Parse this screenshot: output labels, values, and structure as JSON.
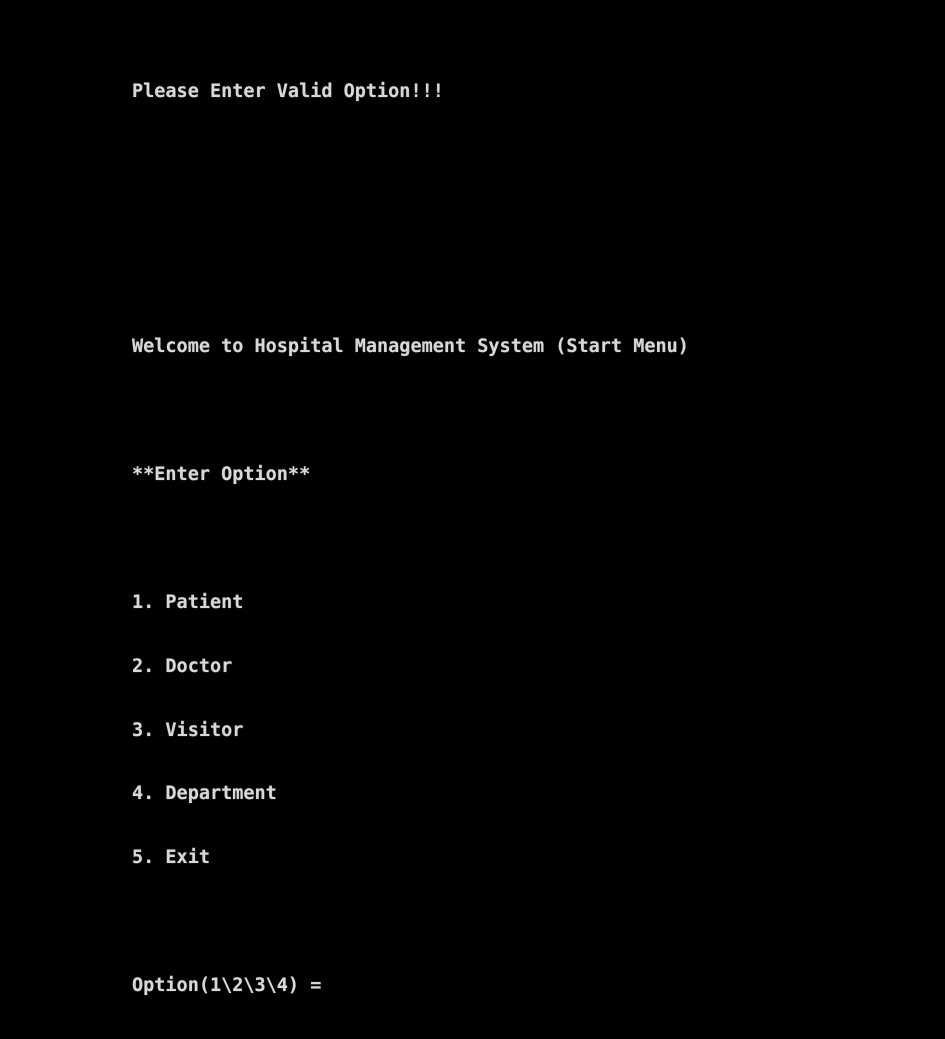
{
  "console": {
    "error_message": "Please Enter Valid Option!!!",
    "welcome_title": "Welcome to Hospital Management System (Start Menu)",
    "enter_option_heading": "**Enter Option**",
    "menu_items": [
      {
        "label": "1. Patient"
      },
      {
        "label": "2. Doctor"
      },
      {
        "label": "3. Visitor"
      },
      {
        "label": "4. Department"
      },
      {
        "label": "5. Exit"
      }
    ],
    "prompt": "Option(1\\2\\3\\4) = ",
    "input_value": ""
  },
  "colors": {
    "background": "#000000",
    "text": "#d8d8d8"
  }
}
